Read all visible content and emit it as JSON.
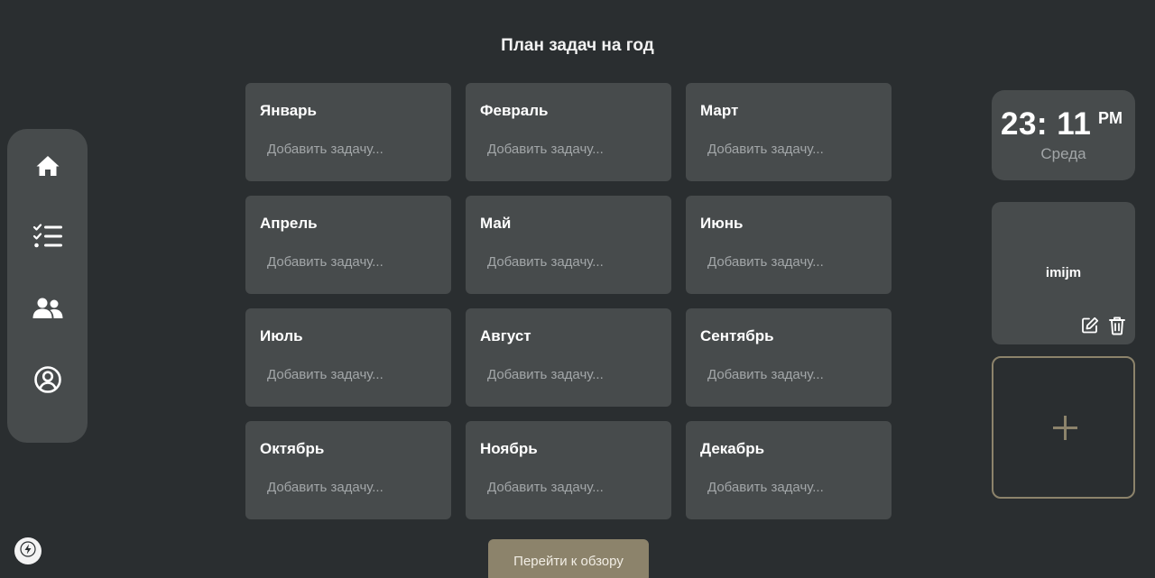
{
  "title": "План задач на год",
  "sidebar": {
    "items": [
      {
        "icon": "home-icon"
      },
      {
        "icon": "checklist-icon"
      },
      {
        "icon": "users-icon"
      },
      {
        "icon": "user-circle-icon"
      }
    ]
  },
  "months": [
    {
      "name": "Январь",
      "placeholder": "Добавить задачу..."
    },
    {
      "name": "Февраль",
      "placeholder": "Добавить задачу..."
    },
    {
      "name": "Март",
      "placeholder": "Добавить задачу..."
    },
    {
      "name": "Апрель",
      "placeholder": "Добавить задачу..."
    },
    {
      "name": "Май",
      "placeholder": "Добавить задачу..."
    },
    {
      "name": "Июнь",
      "placeholder": "Добавить задачу..."
    },
    {
      "name": "Июль",
      "placeholder": "Добавить задачу..."
    },
    {
      "name": "Август",
      "placeholder": "Добавить задачу..."
    },
    {
      "name": "Сентябрь",
      "placeholder": "Добавить задачу..."
    },
    {
      "name": "Октябрь",
      "placeholder": "Добавить задачу..."
    },
    {
      "name": "Ноябрь",
      "placeholder": "Добавить задачу..."
    },
    {
      "name": "Декабрь",
      "placeholder": "Добавить задачу..."
    }
  ],
  "overview_button": "Перейти к обзору",
  "clock": {
    "time": "23: 11",
    "ampm": "PM",
    "day": "Среда"
  },
  "note": {
    "text": "imijm",
    "edit_icon": "edit-icon",
    "delete_icon": "trash-icon"
  },
  "add_card": {
    "icon": "plus-icon"
  },
  "badge": {
    "icon": "bolt-icon"
  },
  "colors": {
    "background": "#2a2e30",
    "card": "#474b4c",
    "accent": "#8c836b",
    "muted_text": "#a2a6a8"
  }
}
